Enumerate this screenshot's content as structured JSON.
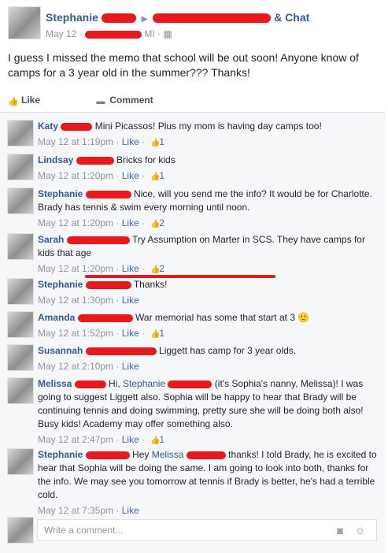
{
  "post": {
    "author": "Stephanie",
    "group_suffix": "& Chat",
    "date": "May 12",
    "location_suffix": "MI",
    "text": "I guess I missed the memo that school will be out soon! Anyone know of camps for a 3 year old in the summer??? Thanks!",
    "like_label": "Like",
    "comment_label": "Comment"
  },
  "comments": [
    {
      "name": "Katy",
      "text": "Mini Picassos! Plus my mom is having day camps too!",
      "time": "May 12 at 1:19pm",
      "like": "Like",
      "count": "1"
    },
    {
      "name": "Lindsay",
      "text": "Bricks for kids",
      "time": "May 12 at 1:20pm",
      "like": "Like",
      "count": "1"
    },
    {
      "name": "Stephanie",
      "text": "Nice, will you send me the info? It would be for Charlotte. Brady has tennis & swim every morning until noon.",
      "time": "May 12 at 1:20pm",
      "like": "Like",
      "count": "2"
    },
    {
      "name": "Sarah",
      "text": "Try Assumption on Marter in SCS. They have camps for kids that age",
      "time": "May 12 at 1:20pm",
      "like": "Like",
      "count": "2"
    },
    {
      "name": "Stephanie",
      "text": "Thanks!",
      "time": "May 12 at 1:30pm",
      "like": "Like",
      "count": ""
    },
    {
      "name": "Amanda",
      "text": "War memorial has some that start at 3 🙂",
      "time": "May 12 at 1:52pm",
      "like": "Like",
      "count": "1"
    },
    {
      "name": "Susannah",
      "text": "Liggett has camp for 3 year olds.",
      "time": "May 12 at 2:10pm",
      "like": "Like",
      "count": ""
    },
    {
      "name": "Melissa",
      "text_a": "Hi, ",
      "mention": "Stephanie",
      "text_b": " (it's Sophia's nanny, Melissa)! I was going to suggest Liggett also. Sophia will be happy to hear that Brady will be continuing tennis and doing swimming, pretty sure she will be doing both also! Busy kids! Academy may offer something also.",
      "time": "May 12 at 2:47pm",
      "like": "Like",
      "count": "1"
    },
    {
      "name": "Stephanie",
      "text_a": "Hey ",
      "mention": "Melissa",
      "text_b": " thanks! I told Brady, he is excited to hear that Sophia will be doing the same. I am going to look into both, thanks for the info. We may see you tomorrow at tennis if Brady is better, he's had a terrible cold.",
      "time": "May 12 at 7:35pm",
      "like": "Like",
      "count": ""
    }
  ],
  "composer": {
    "placeholder": "Write a comment..."
  },
  "colors": {
    "link": "#365899",
    "redaction": "#e8181d",
    "meta": "#90949c"
  }
}
